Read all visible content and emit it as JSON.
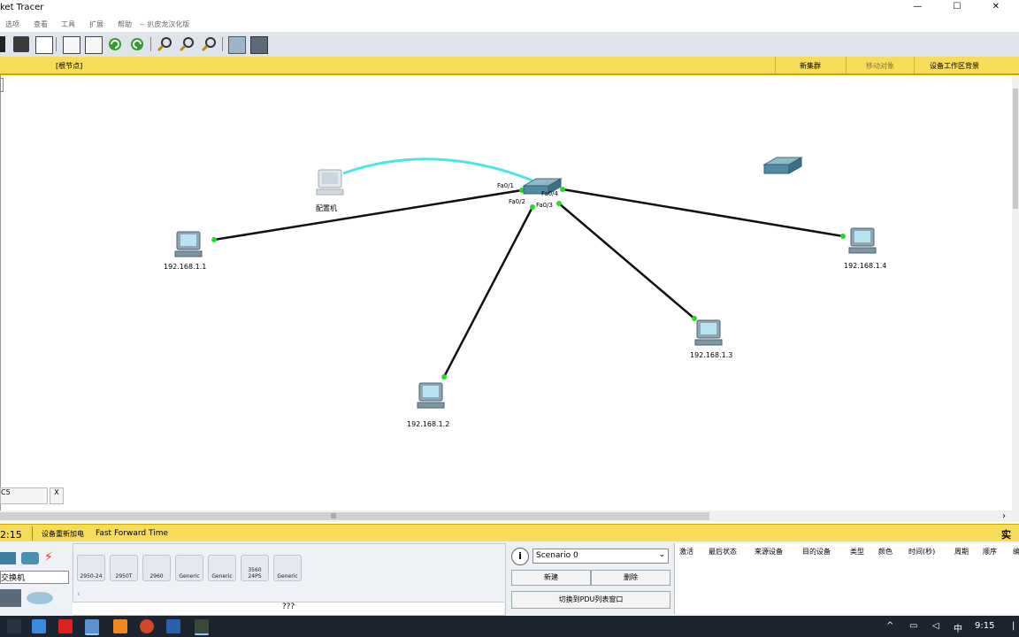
{
  "window": {
    "title": "ket Tracer",
    "controls": "— ☐ ✕"
  },
  "menu": [
    "选项",
    "查看",
    "工具",
    "扩展",
    "帮助",
    "-- 扒皮龙汉化版"
  ],
  "toolbar_icons": [
    "save-icon",
    "print-icon",
    "edit-icon",
    "copy-icon",
    "paste-icon",
    "undo-icon",
    "redo-icon",
    "zoom-in-icon",
    "zoom-reset-icon",
    "zoom-out-icon",
    "palette-icon",
    "device-template-icon"
  ],
  "logic_bar": {
    "root": "[根节点]",
    "new_cluster": "新集群",
    "move_object": "移动对象",
    "set_background": "设备工作区背景"
  },
  "canvas": {
    "config_pc": "配置机",
    "pcs": [
      {
        "id": "pc1",
        "ip": "192.168.1.1"
      },
      {
        "id": "pc2",
        "ip": "192.168.1.2"
      },
      {
        "id": "pc3",
        "ip": "192.168.1.3"
      },
      {
        "id": "pc4",
        "ip": "192.168.1.4"
      }
    ],
    "ports": [
      "Fa0/1",
      "Fa0/2",
      "Fa0/3",
      "Fa0/4"
    ],
    "colors": {
      "link": "#111111",
      "console": "#4fe3e3",
      "port_up": "#22dd22"
    }
  },
  "scenario_tab": {
    "label": "C5",
    "close": "X"
  },
  "status_bar": {
    "time": "2:15",
    "power_cycle": "设备重新加电",
    "fast_forward": "Fast Forward Time",
    "realtime": "实时"
  },
  "device_panel": {
    "category_label": "交换机",
    "devices": [
      "2950-24",
      "2950T",
      "2960",
      "Generic",
      "Generic",
      "3560 24PS",
      "Generic"
    ],
    "device_name": "???"
  },
  "scenario": {
    "info_icon": "i",
    "selected": "Scenario 0",
    "new_btn": "新建",
    "delete_btn": "删除",
    "toggle_pdu": "切换到PDU列表窗口"
  },
  "pdu_columns": [
    "激活",
    "最后状态",
    "来源设备",
    "目的设备",
    "类型",
    "颜色",
    "时间(秒)",
    "周期",
    "顺序",
    "编"
  ],
  "taskbar": {
    "clock": "9:15",
    "ime": "中"
  }
}
